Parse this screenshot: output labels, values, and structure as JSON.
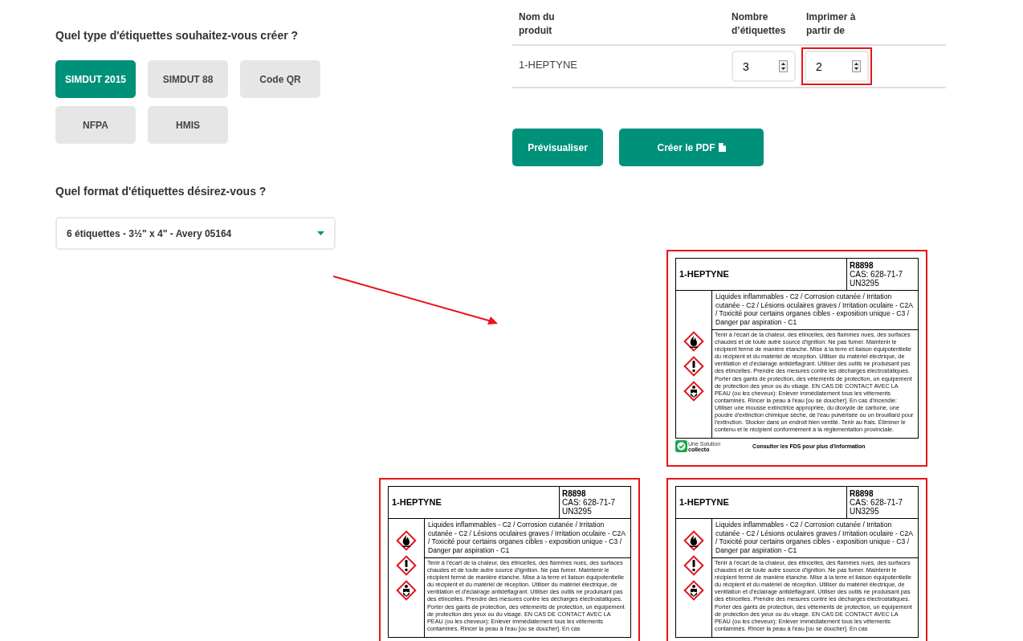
{
  "type_question": "Quel type d'étiquettes souhaitez-vous créer ?",
  "types": [
    {
      "label": "SIMDUT 2015",
      "selected": true
    },
    {
      "label": "SIMDUT 88",
      "selected": false
    },
    {
      "label": "Code QR",
      "selected": false
    },
    {
      "label": "NFPA",
      "selected": false
    },
    {
      "label": "HMIS",
      "selected": false
    }
  ],
  "format_question": "Quel format d'étiquettes désirez-vous ?",
  "format_select": {
    "value": "6 étiquettes - 3½\" x 4\" - Avery 05164"
  },
  "table": {
    "columns": [
      "Nom du produit",
      "Nombre d’étiquettes",
      "Imprimer à partir de"
    ],
    "rows": [
      {
        "product": "1-HEPTYNE",
        "count": "3",
        "start": "2",
        "start_highlighted": true
      }
    ]
  },
  "buttons": [
    {
      "label": "Prévisualiser",
      "kind": "plain"
    },
    {
      "label": "Créer le PDF",
      "kind": "pdf"
    }
  ],
  "sheet": {
    "slots": [
      {
        "kind": "blank"
      },
      {
        "kind": "label",
        "name": "1-HEPTYNE",
        "code": "R8898",
        "cas": "CAS: 628-71-7",
        "un": "UN3295",
        "hazards": "Liquides inflammables - C2 / Corrosion cutanée / Irritation cutanée - C2 / Lésions oculaires graves / Irritation oculaire - C2A / Toxicité pour certains organes cibles - exposition unique - C3 / Danger par aspiration - C1",
        "precautions": "Tenir à l'écart de la chaleur, des étincelles, des flammes nues, des surfaces chaudes et de toute autre source d'ignition. Ne pas fumer.  Maintenir le récipient fermé de manière étanche. Mise à la terre et liaison équipotentielle du récipient et du matériel de réception. Utiliser du matériel électrique, de ventilation et d'éclairage antidéflagrant. Utiliser des outils ne produisant pas des étincelles. Prendre des mesures contre les décharges électrostatiques. Porter des gants de protection, des vêtements de protection, un équipement de protection des yeux ou du visage. EN CAS DE CONTACT AVEC LA PEAU (ou les cheveux): Enlever immédiatement tous les vêtements contaminés. Rincer la peau à l'eau [ou se doucher]. En cas d'incendie: Utiliser une mousse extinctrice appropriée, du dioxyde de carbone, une poudre d'extinction chimique sèche, de l'eau pulvérisée ou un brouillard pour l'extinction. Stocker dans un endroit bien ventilé. Tenir au frais. Éliminer le contenu et le récipient conformément à la réglementation provinciale.",
        "pictograms": [
          {
            "kind": "flame"
          },
          {
            "kind": "exclamation"
          },
          {
            "kind": "health"
          }
        ],
        "footer": {
          "tagline": "Une Solution",
          "brand": "collecto",
          "note": "Consulter les FDS pour plus d'information"
        }
      },
      {
        "kind": "label",
        "name": "1-HEPTYNE",
        "code": "R8898",
        "cas": "CAS: 628-71-7",
        "un": "UN3295",
        "hazards": "Liquides inflammables - C2 / Corrosion cutanée / Irritation cutanée - C2 / Lésions oculaires graves / Irritation oculaire - C2A / Toxicité pour certains organes cibles - exposition unique - C3 / Danger par aspiration - C1",
        "precautions": "Tenir à l'écart de la chaleur, des étincelles, des flammes nues, des surfaces chaudes et de toute autre source d'ignition. Ne pas fumer.  Maintenir le récipient fermé de manière étanche. Mise à la terre et liaison équipotentielle du récipient et du matériel de réception. Utiliser du matériel électrique, de ventilation et d'éclairage antidéflagrant. Utiliser des outils ne produisant pas des étincelles. Prendre des mesures contre les décharges électrostatiques. Porter des gants de protection, des vêtements de protection, un équipement de protection des yeux ou du visage. EN CAS DE CONTACT AVEC LA PEAU (ou les cheveux): Enlever immédiatement tous les vêtements contaminés. Rincer la peau à l'eau [ou se doucher]. En cas",
        "pictograms": [
          {
            "kind": "flame"
          },
          {
            "kind": "exclamation"
          },
          {
            "kind": "health"
          }
        ]
      },
      {
        "kind": "label",
        "name": "1-HEPTYNE",
        "code": "R8898",
        "cas": "CAS: 628-71-7",
        "un": "UN3295",
        "hazards": "Liquides inflammables - C2 / Corrosion cutanée / Irritation cutanée - C2 / Lésions oculaires graves / Irritation oculaire - C2A / Toxicité pour certains organes cibles - exposition unique - C3 / Danger par aspiration - C1",
        "precautions": "Tenir à l'écart de la chaleur, des étincelles, des flammes nues, des surfaces chaudes et de toute autre source d'ignition. Ne pas fumer.  Maintenir le récipient fermé de manière étanche. Mise à la terre et liaison équipotentielle du récipient et du matériel de réception. Utiliser du matériel électrique, de ventilation et d'éclairage antidéflagrant. Utiliser des outils ne produisant pas des étincelles. Prendre des mesures contre les décharges électrostatiques. Porter des gants de protection, des vêtements de protection, un équipement de protection des yeux ou du visage. EN CAS DE CONTACT AVEC LA PEAU (ou les cheveux): Enlever immédiatement tous les vêtements contaminés. Rincer la peau à l'eau [ou se doucher]. En cas",
        "pictograms": [
          {
            "kind": "flame"
          },
          {
            "kind": "exclamation"
          },
          {
            "kind": "health"
          }
        ]
      }
    ]
  }
}
